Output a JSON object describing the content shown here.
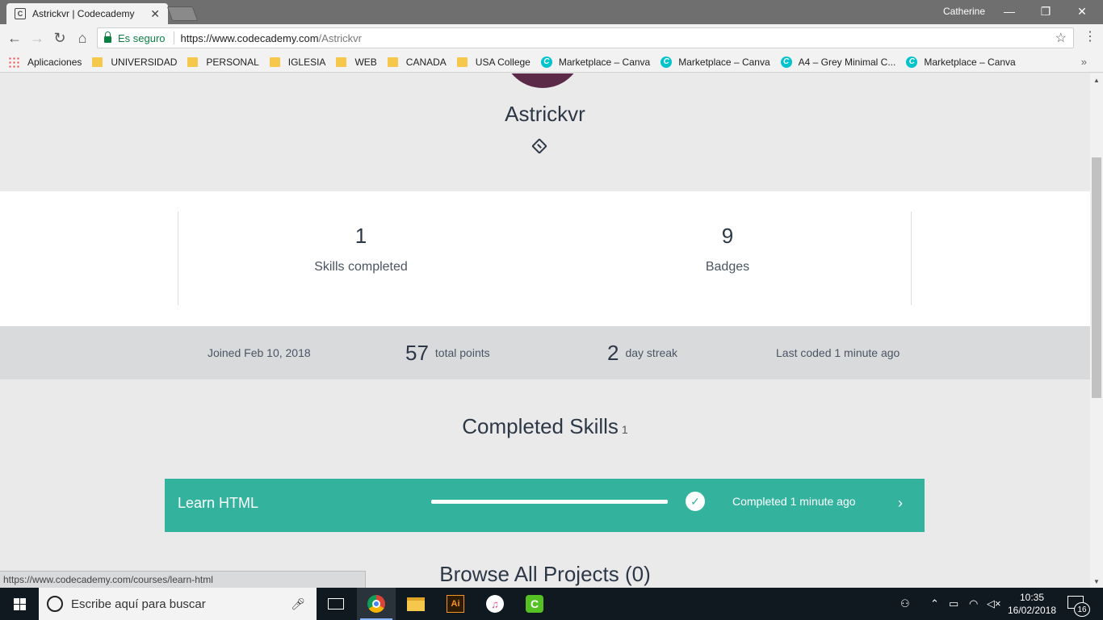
{
  "browser": {
    "tab_title": "Astrickvr | Codecademy",
    "tab_close": "✕",
    "profile_name": "Catherine",
    "minimize": "—",
    "restore": "❐",
    "close": "✕",
    "back": "←",
    "forward": "→",
    "reload": "↻",
    "home": "⌂",
    "secure_label": "Es seguro",
    "url_host": "https://www.codecademy.com",
    "url_path": "/Astrickvr",
    "star": "☆",
    "menu": "⋮"
  },
  "bookmarks": {
    "apps_label": "Aplicaciones",
    "folders": [
      "UNIVERSIDAD",
      "PERSONAL",
      "IGLESIA",
      "WEB",
      "CANADA",
      "USA College"
    ],
    "canva_items": [
      "Marketplace – Canva",
      "Marketplace – Canva",
      "A4 – Grey Minimal C...",
      "Marketplace – Canva"
    ],
    "more": "»"
  },
  "profile": {
    "username": "Astrickvr",
    "skills_completed_value": "1",
    "skills_completed_label": "Skills completed",
    "badges_value": "9",
    "badges_label": "Badges",
    "joined": "Joined Feb 10, 2018",
    "points_value": "57",
    "points_label": "total points",
    "streak_value": "2",
    "streak_label": "day streak",
    "last_coded": "Last coded 1 minute ago"
  },
  "completed_skills": {
    "title": "Completed Skills",
    "count": "1",
    "items": [
      {
        "name": "Learn HTML",
        "progress": 1.0,
        "status": "Completed 1 minute ago",
        "arrow": "›"
      }
    ]
  },
  "projects": {
    "title": "Browse All Projects (0)"
  },
  "status_bar": {
    "url": "https://www.codecademy.com/courses/learn-html"
  },
  "taskbar": {
    "search_placeholder": "Escribe aquí para buscar",
    "time": "10:35",
    "date": "16/02/2018",
    "notifications": "16"
  },
  "colors": {
    "skill_card": "#33b39e",
    "text_dark": "#2d3847",
    "info_strip": "#d9dadc"
  }
}
